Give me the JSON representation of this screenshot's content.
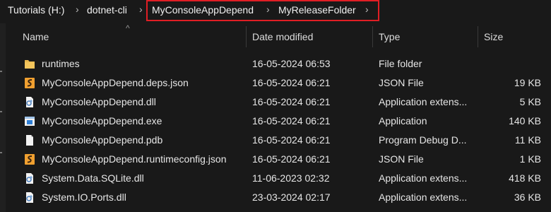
{
  "breadcrumb": {
    "items": [
      "Tutorials (H:)",
      "dotnet-cli",
      "MyConsoleAppDepend",
      "MyReleaseFolder"
    ]
  },
  "columns": {
    "name": "Name",
    "date": "Date modified",
    "type": "Type",
    "size": "Size"
  },
  "files": [
    {
      "icon": "folder-icon",
      "name": "runtimes",
      "date": "16-05-2024 06:53",
      "type": "File folder",
      "size": ""
    },
    {
      "icon": "json-file-icon",
      "name": "MyConsoleAppDepend.deps.json",
      "date": "16-05-2024 06:21",
      "type": "JSON File",
      "size": "19 KB"
    },
    {
      "icon": "dll-file-icon",
      "name": "MyConsoleAppDepend.dll",
      "date": "16-05-2024 06:21",
      "type": "Application extens...",
      "size": "5 KB"
    },
    {
      "icon": "exe-file-icon",
      "name": "MyConsoleAppDepend.exe",
      "date": "16-05-2024 06:21",
      "type": "Application",
      "size": "140 KB"
    },
    {
      "icon": "blank-file-icon",
      "name": "MyConsoleAppDepend.pdb",
      "date": "16-05-2024 06:21",
      "type": "Program Debug D...",
      "size": "11 KB"
    },
    {
      "icon": "json-file-icon",
      "name": "MyConsoleAppDepend.runtimeconfig.json",
      "date": "16-05-2024 06:21",
      "type": "JSON File",
      "size": "1 KB"
    },
    {
      "icon": "dll-file-icon",
      "name": "System.Data.SQLite.dll",
      "date": "11-06-2023 02:32",
      "type": "Application extens...",
      "size": "418 KB"
    },
    {
      "icon": "dll-file-icon",
      "name": "System.IO.Ports.dll",
      "date": "23-03-2024 02:17",
      "type": "Application extens...",
      "size": "36 KB"
    }
  ],
  "colors": {
    "highlight": "#e01e24",
    "folder": "#e8b64c",
    "json": "#f0a030",
    "exe": "#2f7fd6"
  }
}
